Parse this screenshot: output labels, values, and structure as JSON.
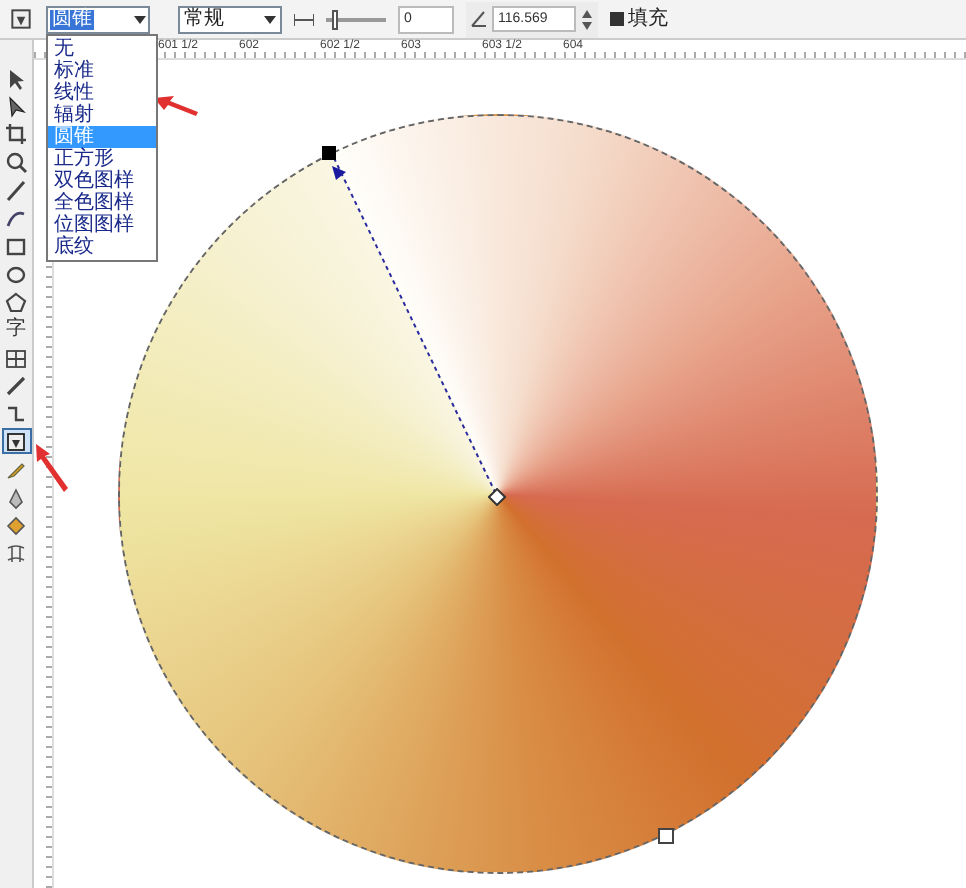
{
  "toolbar": {
    "fill_type": {
      "value": "圆锥",
      "open": true,
      "options": [
        {
          "label": "无",
          "selected": false
        },
        {
          "label": "标准",
          "selected": false
        },
        {
          "label": "线性",
          "selected": false
        },
        {
          "label": "辐射",
          "selected": false
        },
        {
          "label": "圆锥",
          "selected": true
        },
        {
          "label": "正方形",
          "selected": false
        },
        {
          "label": "双色图样",
          "selected": false
        },
        {
          "label": "全色图样",
          "selected": false
        },
        {
          "label": "位图图样",
          "selected": false
        },
        {
          "label": "底纹",
          "selected": false
        }
      ]
    },
    "mode": {
      "value": "常规"
    },
    "midpoint": {
      "value": "0",
      "level": 0.1
    },
    "angle": {
      "value": "116.569"
    },
    "fill_checkbox": {
      "label": "填充",
      "checked": true
    }
  },
  "ruler": {
    "labels": [
      "601 1/2",
      "602",
      "602 1/2",
      "603",
      "603 1/2",
      "604"
    ]
  },
  "tools": [
    {
      "kind": "pick",
      "selected": false
    },
    {
      "kind": "shape",
      "selected": false
    },
    {
      "kind": "crop",
      "selected": false
    },
    {
      "kind": "zoom",
      "selected": false
    },
    {
      "kind": "freehand",
      "selected": false
    },
    {
      "kind": "smart",
      "selected": false
    },
    {
      "kind": "rectangle",
      "selected": false
    },
    {
      "kind": "ellipse",
      "selected": false
    },
    {
      "kind": "polygon",
      "selected": false
    },
    {
      "kind": "text",
      "glyph": "字",
      "selected": false
    },
    {
      "kind": "table",
      "selected": false
    },
    {
      "kind": "dimension",
      "selected": false
    },
    {
      "kind": "connector",
      "selected": false
    },
    {
      "kind": "interactive",
      "selected": true
    },
    {
      "kind": "eyedropper",
      "selected": false
    },
    {
      "kind": "outline",
      "selected": false
    },
    {
      "kind": "fill",
      "selected": false
    },
    {
      "kind": "mesh",
      "selected": false
    }
  ]
}
